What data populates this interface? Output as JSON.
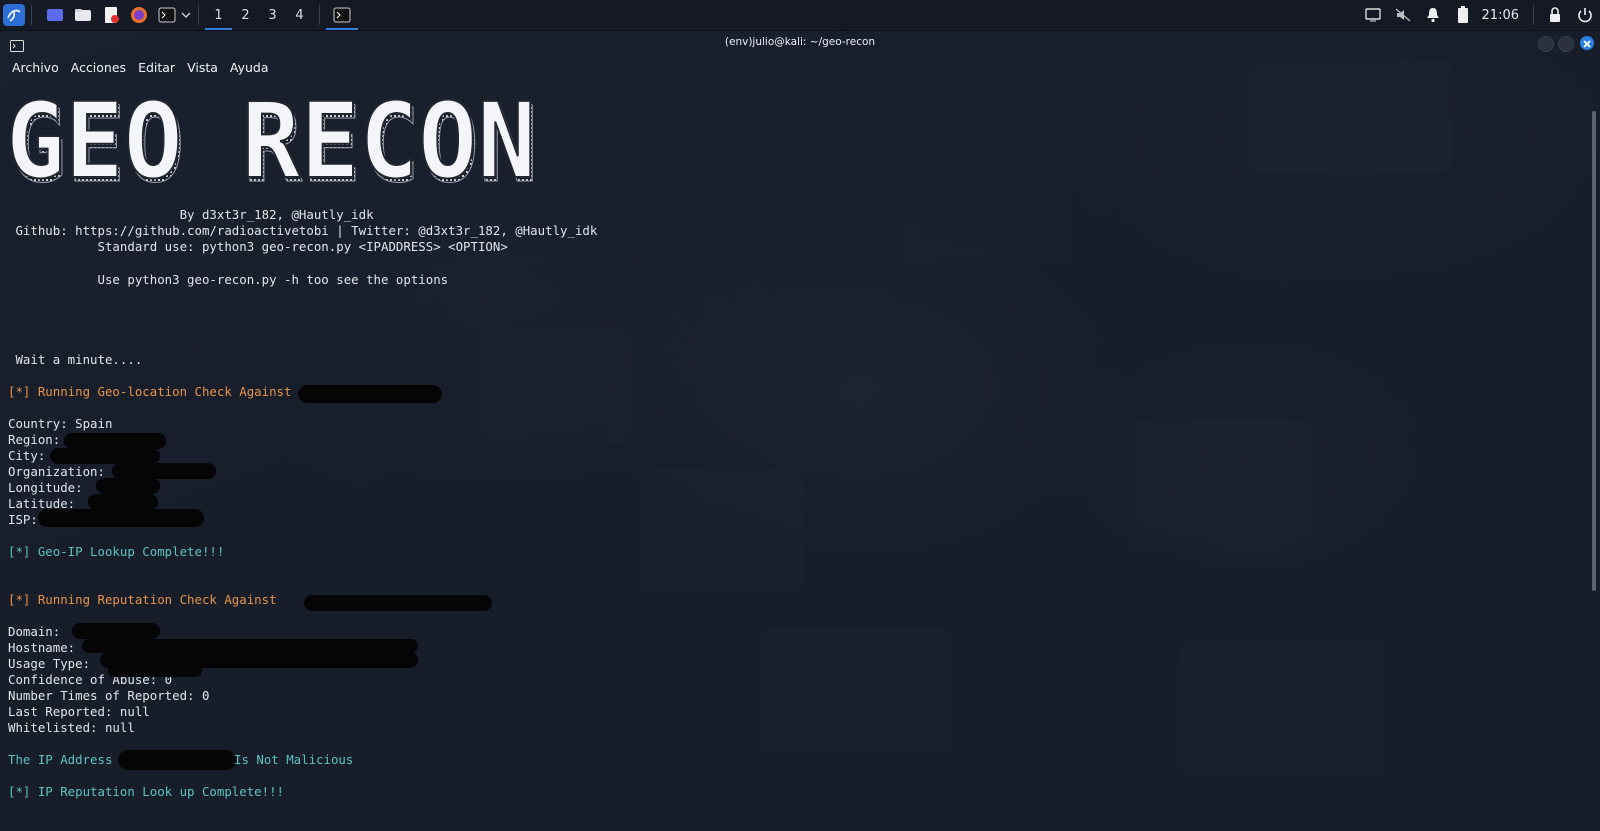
{
  "taskbar": {
    "workspaces": [
      "1",
      "2",
      "3",
      "4"
    ],
    "active_workspace": "1",
    "clock": "21:06",
    "icons": [
      "kali-menu-icon",
      "desktop-icon",
      "file-manager-icon",
      "text-editor-icon",
      "firefox-icon",
      "terminal-icon",
      "chevron-down-icon"
    ],
    "tray_icons": [
      "screen-icon",
      "volume-muted-icon",
      "bell-icon",
      "battery-icon",
      "lock-icon",
      "power-icon"
    ]
  },
  "window": {
    "title": "(env)julio@kali: ~/geo-recon",
    "menu": [
      "Archivo",
      "Acciones",
      "Editar",
      "Vista",
      "Ayuda"
    ]
  },
  "terminal": {
    "banner_text": "GEO RECON",
    "author_line": "                       By d3xt3r_182, @Hautly_idk",
    "github_line": " Github: https://github.com/radioactivetobi | Twitter: @d3xt3r_182, @Hautly_idk",
    "usage_line": "            Standard use: python3 geo-recon.py <IPADDRESS> <OPTION>",
    "help_line": "            Use python3 geo-recon.py -h too see the options",
    "wait_line": " Wait a minute....",
    "geo_running": "[*] Running Geo-location Check Against",
    "country": "Country: Spain",
    "region": "Region:",
    "city": "City:",
    "organization": "Organization:",
    "longitude": "Longitude:",
    "latitude": "Latitude:",
    "isp": "ISP:",
    "geo_complete": "[*] Geo-IP Lookup Complete!!!",
    "rep_running": "[*] Running Reputation Check Against",
    "domain": "Domain:",
    "hostname": "Hostname:",
    "usage_type": "Usage Type:",
    "confidence": "Confidence of Abuse: 0",
    "times_reported": "Number Times of Reported: 0",
    "last_reported": "Last Reported: null",
    "whitelisted": "Whitelisted: null",
    "ip_prefix": "The IP Address",
    "ip_suffix": "Is Not Malicious",
    "rep_complete": "[*] IP Reputation Look up Complete!!!"
  },
  "colors": {
    "orange": "#e6934a",
    "teal": "#5cc2c0",
    "accent": "#2f7fe0"
  }
}
